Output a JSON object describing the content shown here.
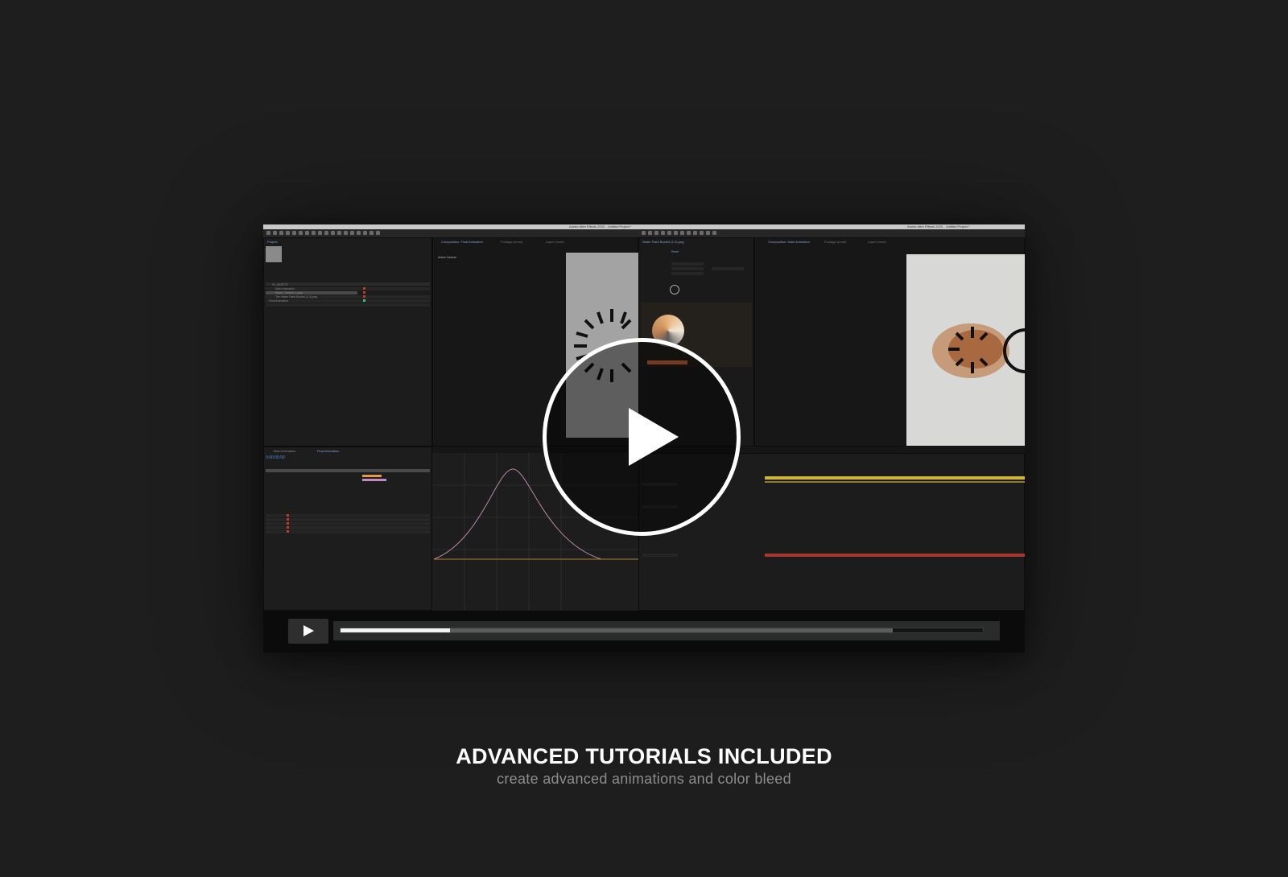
{
  "video": {
    "screen": {
      "left_window_title": "Adobe After Effects 2020 - Untitled Project *",
      "right_window_title": "Adobe After Effects 2020 - Untitled Project *",
      "project_tab": "Project",
      "composition_tab": "Composition: Final Animation",
      "composition_tab_right": "Composition: Main Animation",
      "active_camera": "Active Camera",
      "effect_controls_tab": "Water Paint Bucket (1-3).png",
      "reset_label": "Reset",
      "timecode": "0:00:00:00",
      "timeline_tab_1": "Main Animation",
      "timeline_tab_2": "Final Animation",
      "footage_tab": "Footage (none)",
      "layer_tab": "Layer (none)",
      "project_items": [
        "01_ASSETS",
        "Main Animation",
        "Paper_Texture_1.png",
        "The Water Paint Bucket (1-3).png",
        "Final Animation"
      ]
    },
    "controls": {
      "progress_played": 0.17,
      "progress_buffered": 0.86
    },
    "icons": {
      "center_play": "play-icon",
      "bar_play": "play-icon"
    }
  },
  "caption": {
    "title": "ADVANCED TUTORIALS INCLUDED",
    "subtitle": "create advanced animations and color bleed"
  }
}
